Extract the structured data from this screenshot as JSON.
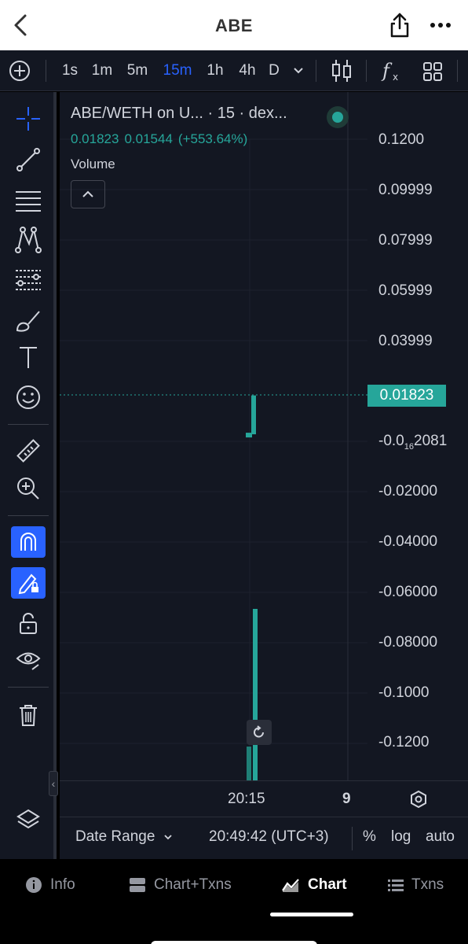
{
  "header": {
    "title": "ABE"
  },
  "toolbar": {
    "intervals": [
      "1s",
      "1m",
      "5m",
      "15m",
      "1h",
      "4h",
      "D"
    ],
    "active_interval": "15m"
  },
  "legend": {
    "title": "ABE/WETH on U... · 15 · dex...",
    "close": "0.01823",
    "change": "0.01544",
    "change_pct": "(+553.64%)",
    "volume_label": "Volume"
  },
  "price_axis": {
    "labels": [
      "0.1200",
      "0.09999",
      "0.07999",
      "0.05999",
      "0.03999",
      "-0.02000",
      "-0.04000",
      "-0.06000",
      "-0.08000",
      "-0.1000",
      "-0.1200"
    ],
    "special_label_prefix": "-0.0",
    "special_label_sub": "16",
    "special_label_suffix": "2081",
    "current_price": "0.01823"
  },
  "time_axis": {
    "labels": [
      "20:15"
    ],
    "extra": "9"
  },
  "chart_footer": {
    "date_range": "Date Range",
    "clock": "20:49:42 (UTC+3)",
    "percent": "%",
    "log": "log",
    "auto": "auto"
  },
  "tabs": {
    "info": "Info",
    "chart_txns": "Chart+Txns",
    "chart": "Chart",
    "txns": "Txns",
    "active": "Chart"
  },
  "colors": {
    "background": "#131722",
    "up": "#26a69a",
    "accent": "#2962ff",
    "text": "#d1d4dc"
  },
  "chart_data": {
    "type": "candlestick",
    "x": [
      "20:15"
    ],
    "ohlc": [
      {
        "open": 0.00279,
        "high": 0.01823,
        "low": 0.00279,
        "close": 0.01823
      }
    ],
    "volume_visible": true,
    "current_price": 0.01823
  }
}
